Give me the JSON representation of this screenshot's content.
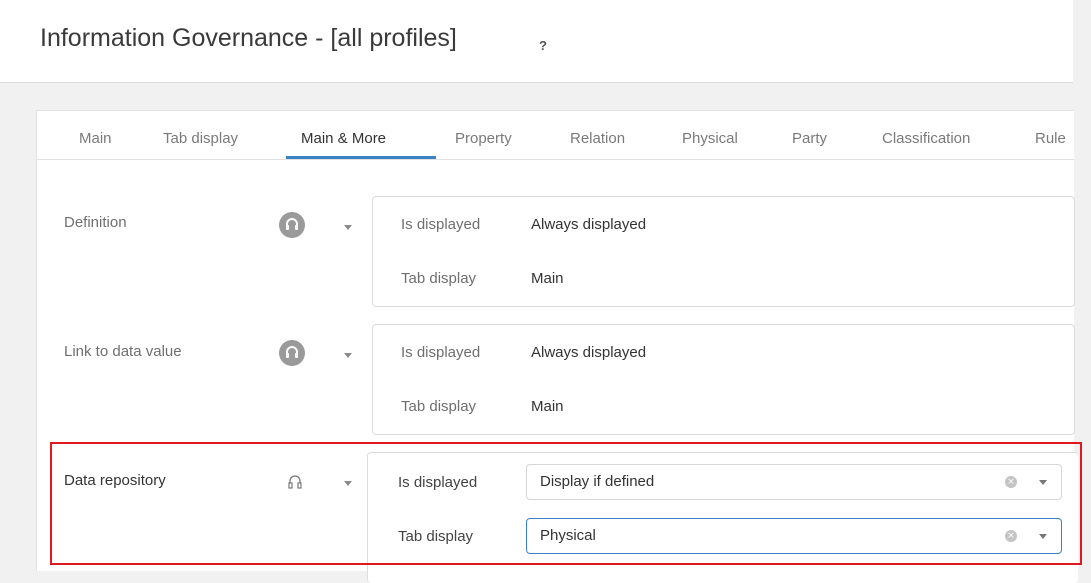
{
  "header": {
    "title": "Information Governance - [all profiles]",
    "help_mark": "?"
  },
  "tabs": [
    {
      "label": "Main"
    },
    {
      "label": "Tab display"
    },
    {
      "label": "Main & More",
      "active": true
    },
    {
      "label": "Property"
    },
    {
      "label": "Relation"
    },
    {
      "label": "Physical"
    },
    {
      "label": "Party"
    },
    {
      "label": "Classification"
    },
    {
      "label": "Rule"
    }
  ],
  "rows": [
    {
      "label": "Definition",
      "icon": "headset-icon",
      "is_displayed_key": "Is displayed",
      "is_displayed_value": "Always displayed",
      "tab_display_key": "Tab display",
      "tab_display_value": "Main"
    },
    {
      "label": "Link to data value",
      "icon": "headset-icon",
      "is_displayed_key": "Is displayed",
      "is_displayed_value": "Always displayed",
      "tab_display_key": "Tab display",
      "tab_display_value": "Main"
    },
    {
      "label": "Data repository",
      "icon": "headset-outline-icon",
      "is_displayed_key": "Is displayed",
      "is_displayed_value": "Display if defined",
      "tab_display_key": "Tab display",
      "tab_display_value": "Physical",
      "clear_mark": "×"
    }
  ],
  "colors": {
    "accent": "#3b82c4",
    "highlight": "#e0181f"
  }
}
